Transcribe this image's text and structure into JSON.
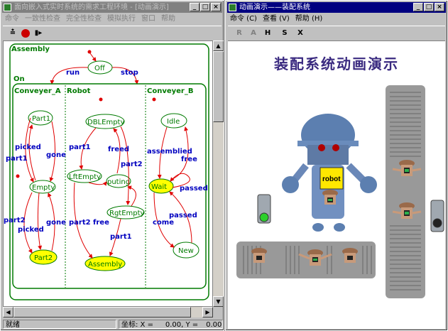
{
  "left_window": {
    "title": "面向嵌入式实时系统的需求工程环境 - [动画演示]",
    "menu": [
      "命令",
      "一致性检查",
      "完全性检查",
      "模拟执行",
      "窗口",
      "帮助"
    ],
    "statechart": {
      "root": "Assembly",
      "off_state": "Off",
      "on_state": "On",
      "run_label": "run",
      "stop_label": "stop",
      "regions": [
        "Conveyer_A",
        "Robot",
        "Conveyer_B"
      ],
      "conveyer_a": {
        "states": [
          "Part1",
          "Empty",
          "Part2"
        ],
        "transitions": [
          "picked",
          "part1",
          "gone",
          "part2",
          "picked",
          "gone"
        ]
      },
      "robot": {
        "states": [
          "DBLEmpty",
          "LftEmpty",
          "puting",
          "RgtEmpty",
          "Assembly"
        ],
        "transitions": [
          "part1",
          "freed",
          "part2",
          "part2",
          "free",
          "part1"
        ]
      },
      "conveyer_b": {
        "states": [
          "Idle",
          "Wait",
          "New"
        ],
        "transitions": [
          "assemblied",
          "free",
          "passed",
          "come",
          "passed"
        ]
      },
      "active_states": [
        "Part2",
        "Assembly",
        "Wait"
      ],
      "colors": {
        "state_border": "#007a00",
        "active_fill": "#ffff00",
        "transition": "#e00000",
        "label": "#0000c0"
      }
    },
    "status": {
      "ready": "就绪",
      "coord_label": "坐标: X =",
      "x": "0.00",
      "y_label": "Y =",
      "y": "0.00"
    }
  },
  "right_window": {
    "title": "动画演示——装配系统",
    "menu": [
      "命令 (C)",
      "查看 (V)",
      "帮助 (H)"
    ],
    "toolbar": [
      "R",
      "A",
      "H",
      "S",
      "X"
    ],
    "heading": "装配系统动画演示",
    "robot_label": "robot"
  }
}
